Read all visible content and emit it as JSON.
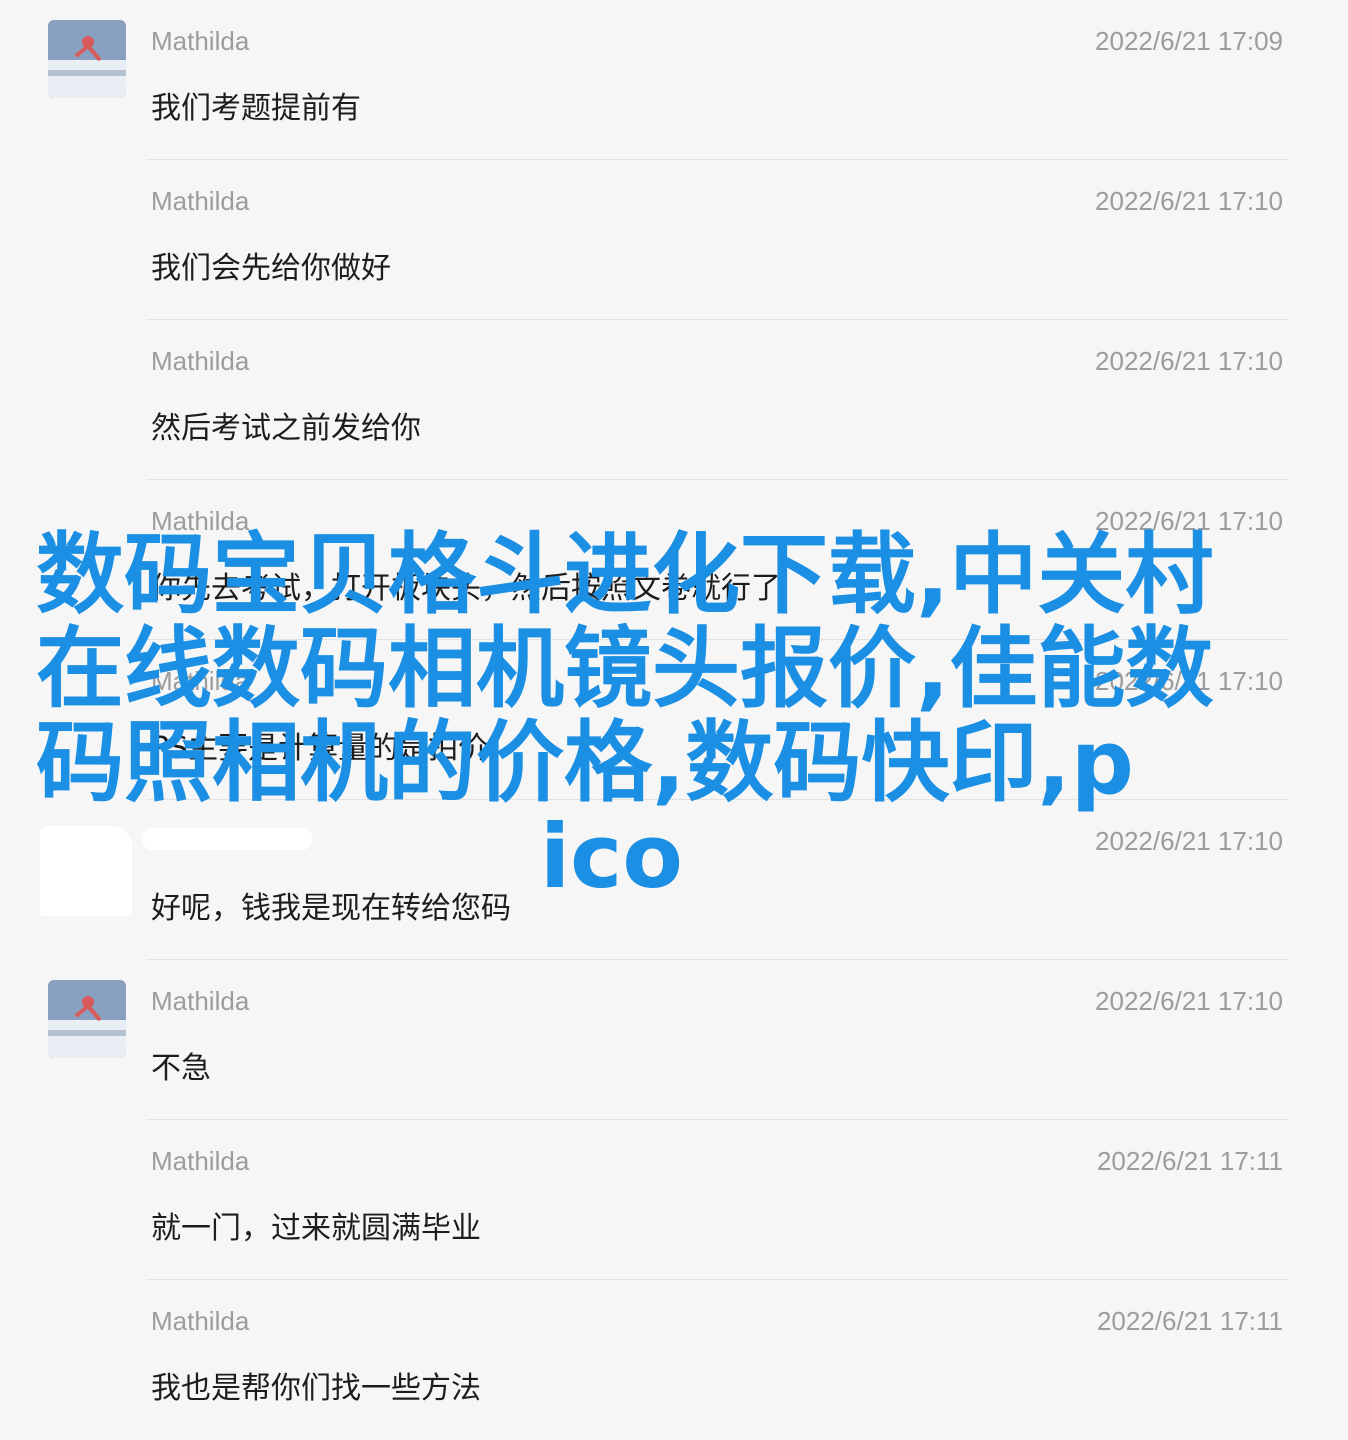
{
  "messages": [
    {
      "sender": "Mathilda",
      "time": "2022/6/21 17:09",
      "text": "我们考题提前有",
      "avatar": true
    },
    {
      "sender": "Mathilda",
      "time": "2022/6/21 17:10",
      "text": "我们会先给你做好",
      "avatar": false
    },
    {
      "sender": "Mathilda",
      "time": "2022/6/21 17:10",
      "text": "然后考试之前发给你",
      "avatar": false
    },
    {
      "sender": "Mathilda",
      "time": "2022/6/21 17:10",
      "text": "你先去考试，打开板块头，然后按照文卷就行了",
      "avatar": false
    },
    {
      "sender": "Mathilda",
      "time": "2022/6/21 17:10",
      "text": "PS主要是计算量的是拍价",
      "avatar": false
    },
    {
      "sender": "",
      "time": "2022/6/21 17:10",
      "text": "好呢，钱我是现在转给您码",
      "avatar": false
    },
    {
      "sender": "Mathilda",
      "time": "2022/6/21 17:10",
      "text": "不急",
      "avatar": true
    },
    {
      "sender": "Mathilda",
      "time": "2022/6/21 17:11",
      "text": "就一门，过来就圆满毕业",
      "avatar": false
    },
    {
      "sender": "Mathilda",
      "time": "2022/6/21 17:11",
      "text": "我也是帮你们找一些方法",
      "avatar": false
    }
  ],
  "overlay": {
    "line1": "数码宝贝格斗进化下载,中关村在线数码相机镜头报价,佳能数码照相机的价格,数码快印,p",
    "line2": "ico"
  },
  "colors": {
    "background": "#f6f6f6",
    "overlay_text": "#1a8fe3",
    "meta_text": "#9c9c9c",
    "message_text": "#1d1d1d"
  }
}
